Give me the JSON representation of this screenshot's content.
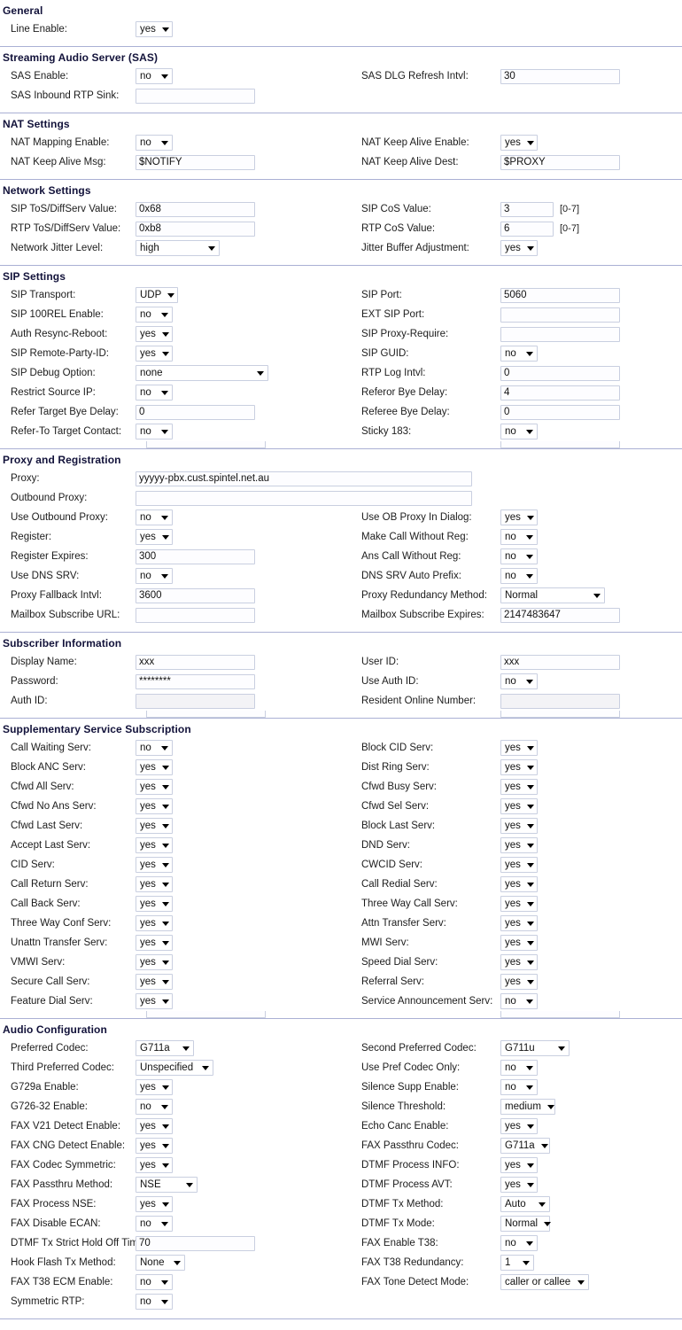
{
  "sections": [
    {
      "id": "general",
      "title": "General",
      "left": [
        {
          "label": "Line Enable:",
          "type": "select",
          "value": "yes",
          "w": "w42"
        }
      ],
      "right": []
    },
    {
      "id": "sas",
      "title": "Streaming Audio Server (SAS)",
      "left": [
        {
          "label": "SAS Enable:",
          "type": "select",
          "value": "no",
          "w": "w42"
        },
        {
          "label": "SAS Inbound RTP Sink:",
          "type": "text",
          "value": "",
          "w": "w135"
        }
      ],
      "right": [
        {
          "label": "SAS DLG Refresh Intvl:",
          "type": "text",
          "value": "30",
          "w": "w135"
        }
      ]
    },
    {
      "id": "nat-settings",
      "title": "NAT Settings",
      "left": [
        {
          "label": "NAT Mapping Enable:",
          "type": "select",
          "value": "no",
          "w": "w42"
        },
        {
          "label": "NAT Keep Alive Msg:",
          "type": "text",
          "value": "$NOTIFY",
          "w": "w135"
        }
      ],
      "right": [
        {
          "label": "NAT Keep Alive Enable:",
          "type": "select",
          "value": "yes",
          "w": "w42"
        },
        {
          "label": "NAT Keep Alive Dest:",
          "type": "text",
          "value": "$PROXY",
          "w": "w135"
        }
      ]
    },
    {
      "id": "network-settings",
      "title": "Network Settings",
      "left": [
        {
          "label": "SIP ToS/DiffServ Value:",
          "type": "text",
          "value": "0x68",
          "w": "w135"
        },
        {
          "label": "RTP ToS/DiffServ Value:",
          "type": "text",
          "value": "0xb8",
          "w": "w135"
        },
        {
          "label": "Network Jitter Level:",
          "type": "select",
          "value": "high",
          "w": "w95"
        }
      ],
      "right": [
        {
          "label": "SIP CoS Value:",
          "type": "text",
          "value": "3",
          "w": "w60",
          "hint": "[0-7]"
        },
        {
          "label": "RTP CoS Value:",
          "type": "text",
          "value": "6",
          "w": "w60",
          "hint": "[0-7]"
        },
        {
          "label": "Jitter Buffer Adjustment:",
          "type": "select",
          "value": "yes",
          "w": "w42"
        }
      ]
    },
    {
      "id": "sip-settings",
      "title": "SIP Settings",
      "ghost": true,
      "left": [
        {
          "label": "SIP Transport:",
          "type": "select",
          "value": "UDP",
          "w": "w48"
        },
        {
          "label": "SIP 100REL Enable:",
          "type": "select",
          "value": "no",
          "w": "w42"
        },
        {
          "label": "Auth Resync-Reboot:",
          "type": "select",
          "value": "yes",
          "w": "w42"
        },
        {
          "label": "SIP Remote-Party-ID:",
          "type": "select",
          "value": "yes",
          "w": "w42"
        },
        {
          "label": "SIP Debug Option:",
          "type": "select",
          "value": "none",
          "w": "w150"
        },
        {
          "label": "Restrict Source IP:",
          "type": "select",
          "value": "no",
          "w": "w42"
        },
        {
          "label": "Refer Target Bye Delay:",
          "type": "text",
          "value": "0",
          "w": "w135"
        },
        {
          "label": "Refer-To Target Contact:",
          "type": "select",
          "value": "no",
          "w": "w42"
        }
      ],
      "right": [
        {
          "label": "SIP Port:",
          "type": "text",
          "value": "5060",
          "w": "w135"
        },
        {
          "label": "EXT SIP Port:",
          "type": "text",
          "value": "",
          "w": "w135"
        },
        {
          "label": "SIP Proxy-Require:",
          "type": "text",
          "value": "",
          "w": "w135"
        },
        {
          "label": "SIP GUID:",
          "type": "select",
          "value": "no",
          "w": "w42"
        },
        {
          "label": "RTP Log Intvl:",
          "type": "text",
          "value": "0",
          "w": "w135"
        },
        {
          "label": "Referor Bye Delay:",
          "type": "text",
          "value": "4",
          "w": "w135"
        },
        {
          "label": "Referee Bye Delay:",
          "type": "text",
          "value": "0",
          "w": "w135"
        },
        {
          "label": "Sticky 183:",
          "type": "select",
          "value": "no",
          "w": "w42"
        }
      ]
    },
    {
      "id": "proxy-registration",
      "title": "Proxy and Registration",
      "left": [
        {
          "label": "Proxy:",
          "type": "text",
          "value": "yyyyy-pbx.cust.spintel.net.au",
          "w": "w380",
          "full": true
        },
        {
          "label": "Outbound Proxy:",
          "type": "text",
          "value": "",
          "w": "w380",
          "full": true
        },
        {
          "label": "Use Outbound Proxy:",
          "type": "select",
          "value": "no",
          "w": "w42"
        },
        {
          "label": "Register:",
          "type": "select",
          "value": "yes",
          "w": "w42"
        },
        {
          "label": "Register Expires:",
          "type": "text",
          "value": "300",
          "w": "w135"
        },
        {
          "label": "Use DNS SRV:",
          "type": "select",
          "value": "no",
          "w": "w42"
        },
        {
          "label": "Proxy Fallback Intvl:",
          "type": "text",
          "value": "3600",
          "w": "w135"
        },
        {
          "label": "Mailbox Subscribe URL:",
          "type": "text",
          "value": "",
          "w": "w135"
        }
      ],
      "right": [
        {
          "label": "",
          "type": "none"
        },
        {
          "label": "",
          "type": "none"
        },
        {
          "label": "Use OB Proxy In Dialog:",
          "type": "select",
          "value": "yes",
          "w": "w42"
        },
        {
          "label": "Make Call Without Reg:",
          "type": "select",
          "value": "no",
          "w": "w42"
        },
        {
          "label": "Ans Call Without Reg:",
          "type": "select",
          "value": "no",
          "w": "w42"
        },
        {
          "label": "DNS SRV Auto Prefix:",
          "type": "select",
          "value": "no",
          "w": "w42"
        },
        {
          "label": "Proxy Redundancy Method:",
          "type": "select",
          "value": "Normal",
          "w": "w118"
        },
        {
          "label": "Mailbox Subscribe Expires:",
          "type": "text",
          "value": "2147483647",
          "w": "w135"
        }
      ]
    },
    {
      "id": "subscriber-information",
      "title": "Subscriber Information",
      "ghost": true,
      "left": [
        {
          "label": "Display Name:",
          "type": "text",
          "value": "xxx",
          "w": "w135"
        },
        {
          "label": "Password:",
          "type": "text",
          "value": "********",
          "w": "w135"
        },
        {
          "label": "Auth ID:",
          "type": "text",
          "value": "",
          "w": "w135",
          "disabled": true
        }
      ],
      "right": [
        {
          "label": "User ID:",
          "type": "text",
          "value": "xxx",
          "w": "w135"
        },
        {
          "label": "Use Auth ID:",
          "type": "select",
          "value": "no",
          "w": "w42"
        },
        {
          "label": "Resident Online Number:",
          "type": "text",
          "value": "",
          "w": "w135",
          "disabled": true
        }
      ]
    },
    {
      "id": "supplementary-service-subscription",
      "title": "Supplementary Service Subscription",
      "ghost": true,
      "left": [
        {
          "label": "Call Waiting Serv:",
          "type": "select",
          "value": "no",
          "w": "w42"
        },
        {
          "label": "Block ANC Serv:",
          "type": "select",
          "value": "yes",
          "w": "w42"
        },
        {
          "label": "Cfwd All Serv:",
          "type": "select",
          "value": "yes",
          "w": "w42"
        },
        {
          "label": "Cfwd No Ans Serv:",
          "type": "select",
          "value": "yes",
          "w": "w42"
        },
        {
          "label": "Cfwd Last Serv:",
          "type": "select",
          "value": "yes",
          "w": "w42"
        },
        {
          "label": "Accept Last Serv:",
          "type": "select",
          "value": "yes",
          "w": "w42"
        },
        {
          "label": "CID Serv:",
          "type": "select",
          "value": "yes",
          "w": "w42"
        },
        {
          "label": "Call Return Serv:",
          "type": "select",
          "value": "yes",
          "w": "w42"
        },
        {
          "label": "Call Back Serv:",
          "type": "select",
          "value": "yes",
          "w": "w42"
        },
        {
          "label": "Three Way Conf Serv:",
          "type": "select",
          "value": "yes",
          "w": "w42"
        },
        {
          "label": "Unattn Transfer Serv:",
          "type": "select",
          "value": "yes",
          "w": "w42"
        },
        {
          "label": "VMWI Serv:",
          "type": "select",
          "value": "yes",
          "w": "w42"
        },
        {
          "label": "Secure Call Serv:",
          "type": "select",
          "value": "yes",
          "w": "w42"
        },
        {
          "label": "Feature Dial Serv:",
          "type": "select",
          "value": "yes",
          "w": "w42"
        }
      ],
      "right": [
        {
          "label": "Block CID Serv:",
          "type": "select",
          "value": "yes",
          "w": "w42"
        },
        {
          "label": "Dist Ring Serv:",
          "type": "select",
          "value": "yes",
          "w": "w42"
        },
        {
          "label": "Cfwd Busy Serv:",
          "type": "select",
          "value": "yes",
          "w": "w42"
        },
        {
          "label": "Cfwd Sel Serv:",
          "type": "select",
          "value": "yes",
          "w": "w42"
        },
        {
          "label": "Block Last Serv:",
          "type": "select",
          "value": "yes",
          "w": "w42"
        },
        {
          "label": "DND Serv:",
          "type": "select",
          "value": "yes",
          "w": "w42"
        },
        {
          "label": "CWCID Serv:",
          "type": "select",
          "value": "yes",
          "w": "w42"
        },
        {
          "label": "Call Redial Serv:",
          "type": "select",
          "value": "yes",
          "w": "w42"
        },
        {
          "label": "Three Way Call Serv:",
          "type": "select",
          "value": "yes",
          "w": "w42"
        },
        {
          "label": "Attn Transfer Serv:",
          "type": "select",
          "value": "yes",
          "w": "w42"
        },
        {
          "label": "MWI Serv:",
          "type": "select",
          "value": "yes",
          "w": "w42"
        },
        {
          "label": "Speed Dial Serv:",
          "type": "select",
          "value": "yes",
          "w": "w42"
        },
        {
          "label": "Referral Serv:",
          "type": "select",
          "value": "yes",
          "w": "w42"
        },
        {
          "label": "Service Announcement Serv:",
          "type": "select",
          "value": "no",
          "w": "w42"
        }
      ]
    },
    {
      "id": "audio-configuration",
      "title": "Audio Configuration",
      "left": [
        {
          "label": "Preferred Codec:",
          "type": "select",
          "value": "G711a",
          "w": "w66"
        },
        {
          "label": "Third Preferred Codec:",
          "type": "select",
          "value": "Unspecified",
          "w": "w88"
        },
        {
          "label": "G729a Enable:",
          "type": "select",
          "value": "yes",
          "w": "w42"
        },
        {
          "label": "G726-32 Enable:",
          "type": "select",
          "value": "no",
          "w": "w42"
        },
        {
          "label": "FAX V21 Detect Enable:",
          "type": "select",
          "value": "yes",
          "w": "w42"
        },
        {
          "label": "FAX CNG Detect Enable:",
          "type": "select",
          "value": "yes",
          "w": "w42"
        },
        {
          "label": "FAX Codec Symmetric:",
          "type": "select",
          "value": "yes",
          "w": "w42"
        },
        {
          "label": "FAX Passthru Method:",
          "type": "select",
          "value": "NSE",
          "w": "w70"
        },
        {
          "label": "FAX Process NSE:",
          "type": "select",
          "value": "yes",
          "w": "w42"
        },
        {
          "label": "FAX Disable ECAN:",
          "type": "select",
          "value": "no",
          "w": "w42"
        },
        {
          "label": "DTMF Tx Strict Hold Off Time:",
          "type": "text",
          "value": "70",
          "w": "w135"
        },
        {
          "label": "Hook Flash Tx Method:",
          "type": "select",
          "value": "None",
          "w": "w56"
        },
        {
          "label": "FAX T38 ECM Enable:",
          "type": "select",
          "value": "no",
          "w": "w42"
        },
        {
          "label": "Symmetric RTP:",
          "type": "select",
          "value": "no",
          "w": "w42"
        }
      ],
      "right": [
        {
          "label": "Second Preferred Codec:",
          "type": "select",
          "value": "G711u",
          "w": "w78"
        },
        {
          "label": "Use Pref Codec Only:",
          "type": "select",
          "value": "no",
          "w": "w42"
        },
        {
          "label": "Silence Supp Enable:",
          "type": "select",
          "value": "no",
          "w": "w42"
        },
        {
          "label": "Silence Threshold:",
          "type": "select",
          "value": "medium",
          "w": "w62"
        },
        {
          "label": "Echo Canc Enable:",
          "type": "select",
          "value": "yes",
          "w": "w42"
        },
        {
          "label": "FAX Passthru Codec:",
          "type": "select",
          "value": "G711a",
          "w": "w56"
        },
        {
          "label": "DTMF Process INFO:",
          "type": "select",
          "value": "yes",
          "w": "w42"
        },
        {
          "label": "DTMF Process AVT:",
          "type": "select",
          "value": "yes",
          "w": "w42"
        },
        {
          "label": "DTMF Tx Method:",
          "type": "select",
          "value": "Auto",
          "w": "w56"
        },
        {
          "label": "DTMF Tx Mode:",
          "type": "select",
          "value": "Normal",
          "w": "w56"
        },
        {
          "label": "FAX Enable T38:",
          "type": "select",
          "value": "no",
          "w": "w42"
        },
        {
          "label": "FAX T38 Redundancy:",
          "type": "select",
          "value": "1",
          "w": "w38"
        },
        {
          "label": "FAX Tone Detect Mode:",
          "type": "select",
          "value": "caller or callee",
          "w": "w100"
        }
      ]
    }
  ],
  "colors": {
    "divider": "#aab0d4",
    "field_border": "#c9cfe0",
    "text": "#1a1a1a",
    "heading": "#12123a"
  }
}
